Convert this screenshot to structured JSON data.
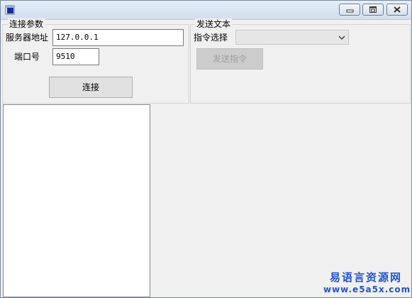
{
  "window": {
    "title": ""
  },
  "connect_group": {
    "title": "连接参数",
    "server_label": "服务器地址",
    "server_value": "127.0.0.1",
    "port_label": "端口号",
    "port_value": "9510",
    "connect_button": "连接"
  },
  "send_group": {
    "title": "发送文本",
    "command_label": "指令选择",
    "command_value": "",
    "send_button": "发送指令"
  },
  "watermark": {
    "line1": "易语言资源网",
    "line2": "www.e5a5x.com"
  },
  "colors": {
    "accent": "#2255cc",
    "title_gradient_top": "#e4edf7",
    "title_gradient_bottom": "#d3dfee"
  }
}
